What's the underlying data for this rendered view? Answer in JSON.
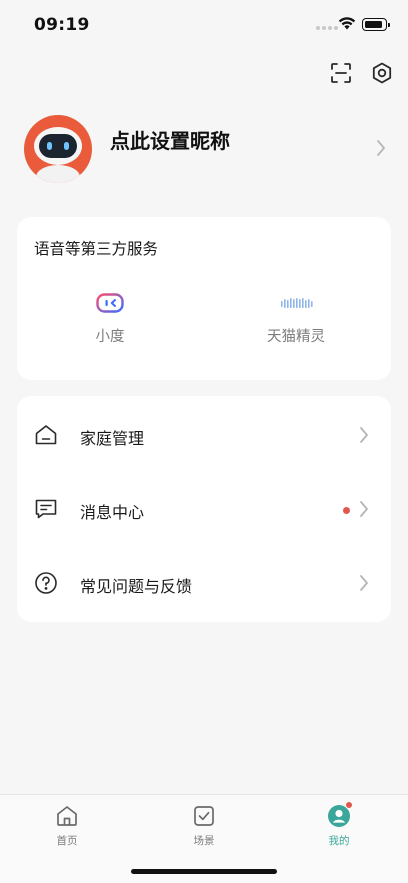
{
  "status_bar": {
    "time": "09:19"
  },
  "top_actions": {
    "scan": "scan-icon",
    "settings": "settings-icon"
  },
  "profile": {
    "nickname": "点此设置昵称",
    "avatar_color": "#e95b3b"
  },
  "services": {
    "title": "语音等第三方服务",
    "items": [
      {
        "label": "小度",
        "icon": "xiaodu-icon"
      },
      {
        "label": "天猫精灵",
        "icon": "tmall-genie-icon"
      }
    ]
  },
  "menu": {
    "items": [
      {
        "label": "家庭管理",
        "icon": "house-icon"
      },
      {
        "label": "消息中心",
        "icon": "message-icon",
        "unread": true
      },
      {
        "label": "常见问题与反馈",
        "icon": "question-icon"
      }
    ]
  },
  "tabs": [
    {
      "label": "首页",
      "icon": "home-icon"
    },
    {
      "label": "场景",
      "icon": "scene-icon"
    },
    {
      "label": "我的",
      "icon": "profile-icon",
      "active": true
    }
  ],
  "colors": {
    "accent": "#3aa79a",
    "badge": "#e0584d",
    "background": "#f6f6f6"
  }
}
